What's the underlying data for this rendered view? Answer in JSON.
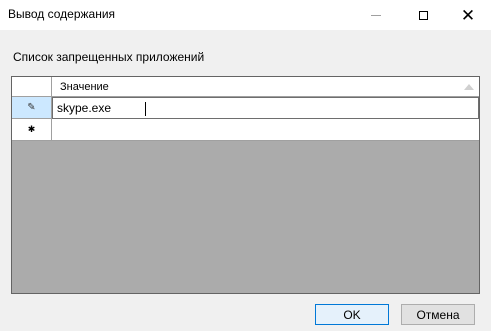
{
  "window": {
    "title": "Вывод содержания",
    "controls": [
      "minimize",
      "maximize",
      "close"
    ]
  },
  "list_label": "Список запрещенных приложений",
  "grid": {
    "column_header": "Значение",
    "rows": [
      {
        "value": "skype.exe",
        "indicator": "pencil-icon",
        "state": "editing"
      },
      {
        "value": "",
        "indicator": "new-row-icon",
        "state": "new"
      }
    ]
  },
  "buttons": {
    "ok": "OK",
    "cancel": "Отмена"
  },
  "colors": {
    "selected_row_header": "#cce8ff",
    "default_button_border": "#0078d7",
    "grid_background": "#ababab"
  }
}
